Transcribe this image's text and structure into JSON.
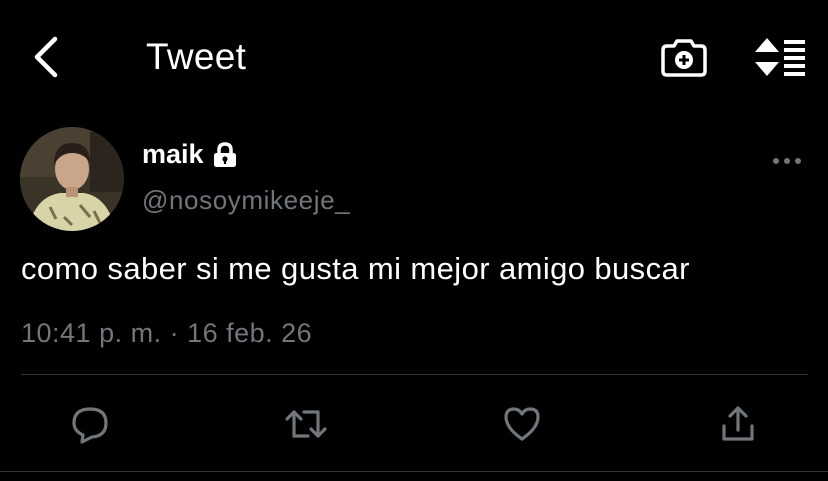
{
  "header": {
    "title": "Tweet"
  },
  "tweet": {
    "display_name": "maik",
    "handle": "@nosoymikeeje_",
    "protected": true,
    "text": "como saber si me gusta mi mejor amigo buscar",
    "timestamp": "10:41 p. m. · 16 feb. 26"
  },
  "icons": {
    "back": "chevron-left-icon",
    "camera": "camera-add-icon",
    "sort": "sort-list-icon",
    "more": "more-horizontal-icon",
    "reply": "reply-icon",
    "retweet": "retweet-icon",
    "like": "heart-icon",
    "share": "share-icon",
    "lock": "lock-icon"
  },
  "colors": {
    "background": "#000000",
    "text": "#ffffff",
    "secondary_text": "#71767b",
    "divider": "#2f3336"
  }
}
